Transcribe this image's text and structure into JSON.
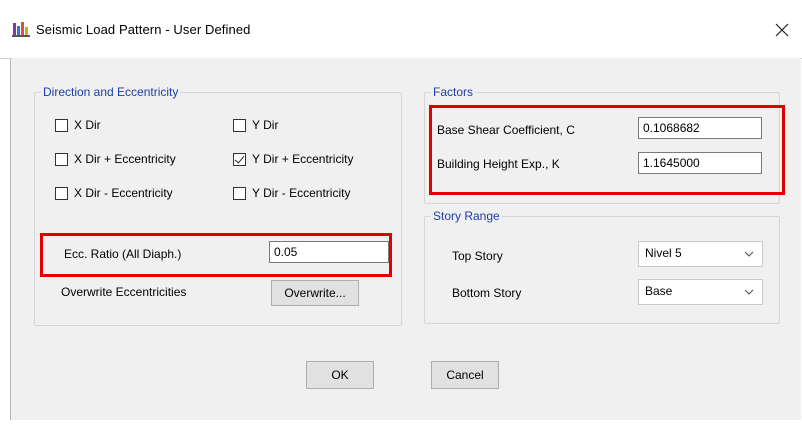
{
  "window": {
    "title": "Seismic Load Pattern - User Defined",
    "close_glyph": "×"
  },
  "direction_group": {
    "label": "Direction and Eccentricity",
    "checkboxes": [
      {
        "label": "X Dir",
        "checked": false
      },
      {
        "label": "Y Dir",
        "checked": false
      },
      {
        "label": "X Dir + Eccentricity",
        "checked": false
      },
      {
        "label": "Y Dir + Eccentricity",
        "checked": true
      },
      {
        "label": "X Dir - Eccentricity",
        "checked": false
      },
      {
        "label": "Y Dir - Eccentricity",
        "checked": false
      }
    ],
    "ecc_ratio_label": "Ecc. Ratio (All Diaph.)",
    "ecc_ratio_value": "0.05",
    "overwrite_label": "Overwrite Eccentricities",
    "overwrite_button": "Overwrite..."
  },
  "factors_group": {
    "label": "Factors",
    "base_shear_label": "Base Shear Coefficient, C",
    "base_shear_value": "0.1068682",
    "height_exp_label": "Building Height Exp., K",
    "height_exp_value": "1.1645000"
  },
  "story_range_group": {
    "label": "Story Range",
    "top_story_label": "Top Story",
    "top_story_value": "Nivel 5",
    "bottom_story_label": "Bottom Story",
    "bottom_story_value": "Base"
  },
  "buttons": {
    "ok": "OK",
    "cancel": "Cancel"
  },
  "colors": {
    "highlight": "#e00000",
    "group_label": "#1d3da8",
    "dialog_bg": "#f0f0f0"
  }
}
